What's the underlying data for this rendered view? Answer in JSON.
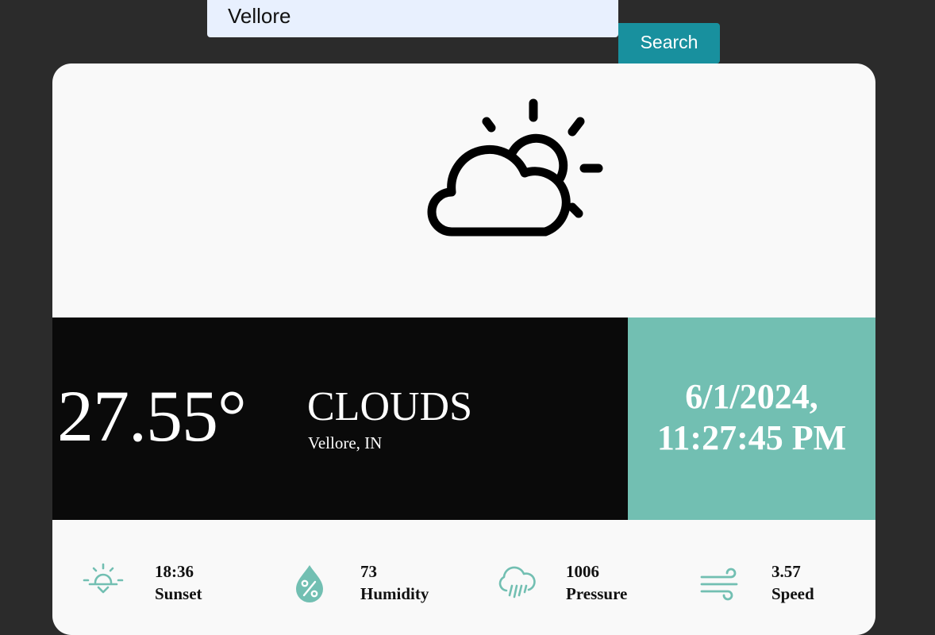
{
  "search": {
    "value": "Vellore",
    "button_label": "Search"
  },
  "current": {
    "icon": "cloud-sun-icon",
    "temperature": "27.55°",
    "condition": "CLOUDS",
    "location": "Vellore, IN"
  },
  "datetime": {
    "date": "6/1/2024,",
    "time": "11:27:45 PM"
  },
  "stats": [
    {
      "value": "18:36",
      "label": "Sunset",
      "icon": "sunset-icon"
    },
    {
      "value": "73",
      "label": "Humidity",
      "icon": "humidity-icon"
    },
    {
      "value": "1006",
      "label": "Pressure",
      "icon": "pressure-icon"
    },
    {
      "value": "3.57",
      "label": "Speed",
      "icon": "wind-icon"
    }
  ],
  "colors": {
    "background": "#2b2b2b",
    "card": "#f9f9f9",
    "temp_panel": "#0a0a0a",
    "date_panel": "#72bfb2",
    "accent": "#18909e",
    "icon_teal": "#72bfb2"
  }
}
